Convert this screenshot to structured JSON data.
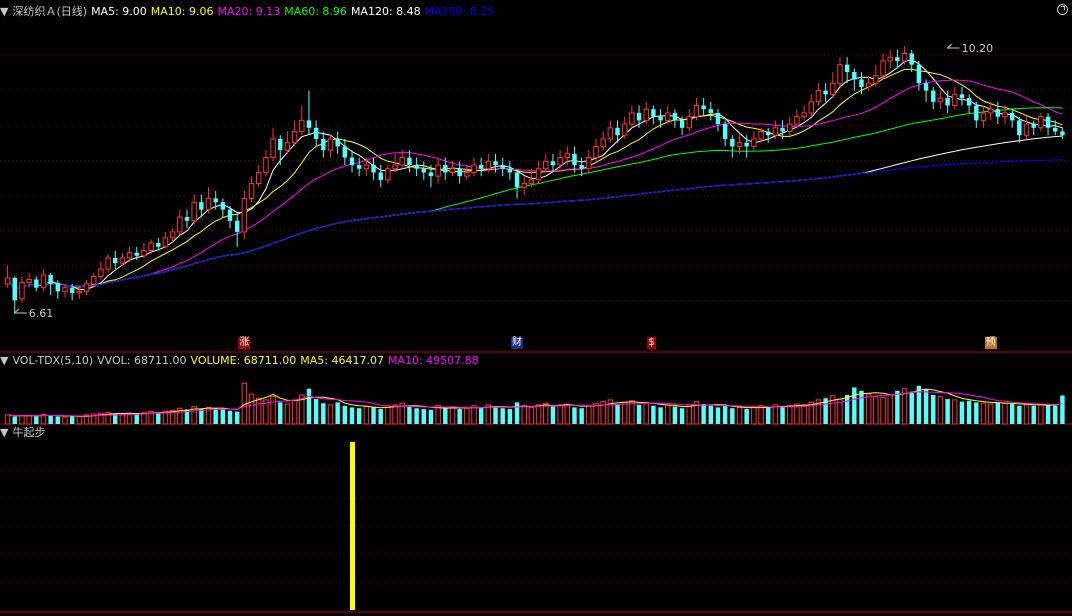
{
  "price_header": {
    "title": "深纺织Ａ(日线)",
    "items": [
      {
        "label": "MA5: 9.00",
        "color": "#ffffff"
      },
      {
        "label": "MA10: 9.06",
        "color": "#ffff00"
      },
      {
        "label": "MA20: 9.13",
        "color": "#ff00ff"
      },
      {
        "label": "MA60: 8.96",
        "color": "#00ff00"
      },
      {
        "label": "MA120: 8.48",
        "color": "#ffffff"
      },
      {
        "label": "MA250: 8.25",
        "color": "#0000ff"
      }
    ]
  },
  "volume_header": {
    "title": "VOL-TDX(5,10)",
    "items": [
      {
        "label": "VVOL: 68711.00",
        "color": "#c8c8c8"
      },
      {
        "label": "VOLUME: 68711.00",
        "color": "#ffff00"
      },
      {
        "label": "MA5: 46417.07",
        "color": "#ffff00"
      },
      {
        "label": "MA10: 49507.88",
        "color": "#ff00ff"
      }
    ]
  },
  "indicator_header": {
    "title": "牛起步"
  },
  "signals": [
    {
      "text": "涨",
      "index": 33,
      "bg": "#a00000"
    },
    {
      "text": "财",
      "index": 71,
      "bg": "#1a2a8c"
    },
    {
      "text": "$",
      "index": 90,
      "bg": "#a00000"
    },
    {
      "text": "预",
      "index": 137,
      "bg": "#c07020"
    }
  ],
  "colors": {
    "up": "#ff3232",
    "down": "#54ffff",
    "grid": "#6e0000",
    "divider": "#b40000",
    "indicator_bar": "#ffff00"
  },
  "chart_data": [
    {
      "type": "candlestick",
      "price_range": [
        6.3,
        10.55
      ],
      "max_label": "10.20",
      "min_label": "6.61",
      "max_value": 10.2,
      "min_value": 6.61,
      "max_index": 131,
      "min_index": 1,
      "ma_periods": [
        5,
        10,
        20,
        60,
        120,
        250
      ],
      "candles": [
        [
          7.0,
          7.08,
          7.25,
          6.95
        ],
        [
          7.08,
          6.78,
          7.1,
          6.61
        ],
        [
          6.8,
          7.02,
          7.1,
          6.75
        ],
        [
          7.02,
          7.06,
          7.15,
          6.95
        ],
        [
          7.06,
          6.95,
          7.1,
          6.9
        ],
        [
          6.95,
          7.12,
          7.2,
          6.9
        ],
        [
          7.12,
          7.0,
          7.15,
          6.85
        ],
        [
          7.0,
          6.9,
          7.05,
          6.8
        ],
        [
          6.9,
          6.95,
          7.0,
          6.82
        ],
        [
          6.95,
          6.88,
          7.0,
          6.78
        ],
        [
          6.88,
          6.9,
          6.98,
          6.8
        ],
        [
          6.9,
          7.0,
          7.05,
          6.85
        ],
        [
          7.0,
          7.1,
          7.15,
          6.95
        ],
        [
          7.1,
          7.2,
          7.3,
          7.05
        ],
        [
          7.2,
          7.35,
          7.4,
          7.15
        ],
        [
          7.35,
          7.28,
          7.45,
          7.2
        ],
        [
          7.28,
          7.35,
          7.42,
          7.25
        ],
        [
          7.35,
          7.42,
          7.5,
          7.3
        ],
        [
          7.42,
          7.38,
          7.5,
          7.32
        ],
        [
          7.38,
          7.45,
          7.55,
          7.35
        ],
        [
          7.45,
          7.55,
          7.6,
          7.4
        ],
        [
          7.55,
          7.5,
          7.62,
          7.45
        ],
        [
          7.5,
          7.62,
          7.7,
          7.48
        ],
        [
          7.62,
          7.7,
          7.75,
          7.55
        ],
        [
          7.7,
          7.9,
          8.0,
          7.65
        ],
        [
          7.9,
          7.85,
          8.0,
          7.75
        ],
        [
          7.85,
          8.1,
          8.2,
          7.8
        ],
        [
          8.1,
          8.0,
          8.2,
          7.9
        ],
        [
          8.0,
          8.15,
          8.3,
          7.95
        ],
        [
          8.15,
          8.1,
          8.25,
          8.0
        ],
        [
          8.1,
          8.0,
          8.15,
          7.9
        ],
        [
          8.0,
          7.85,
          8.05,
          7.75
        ],
        [
          7.85,
          7.7,
          7.95,
          7.5
        ],
        [
          7.7,
          8.15,
          8.25,
          7.6
        ],
        [
          8.15,
          8.35,
          8.45,
          8.1
        ],
        [
          8.35,
          8.5,
          8.6,
          8.3
        ],
        [
          8.5,
          8.7,
          8.8,
          8.45
        ],
        [
          8.7,
          8.95,
          9.1,
          8.65
        ],
        [
          8.95,
          8.8,
          9.0,
          8.6
        ],
        [
          8.8,
          8.9,
          9.05,
          8.75
        ],
        [
          8.9,
          9.05,
          9.2,
          8.85
        ],
        [
          9.05,
          9.2,
          9.4,
          9.0
        ],
        [
          9.2,
          9.1,
          9.6,
          9.0
        ],
        [
          9.1,
          8.95,
          9.2,
          8.85
        ],
        [
          8.95,
          8.8,
          9.05,
          8.7
        ],
        [
          8.8,
          8.95,
          9.0,
          8.7
        ],
        [
          8.95,
          8.85,
          9.05,
          8.75
        ],
        [
          8.85,
          8.7,
          8.95,
          8.6
        ],
        [
          8.7,
          8.6,
          8.8,
          8.5
        ],
        [
          8.6,
          8.55,
          8.7,
          8.45
        ],
        [
          8.55,
          8.6,
          8.7,
          8.45
        ],
        [
          8.6,
          8.5,
          8.7,
          8.4
        ],
        [
          8.5,
          8.4,
          8.6,
          8.3
        ],
        [
          8.4,
          8.55,
          8.6,
          8.35
        ],
        [
          8.55,
          8.6,
          8.75,
          8.5
        ],
        [
          8.6,
          8.7,
          8.8,
          8.55
        ],
        [
          8.7,
          8.6,
          8.8,
          8.5
        ],
        [
          8.6,
          8.55,
          8.7,
          8.45
        ],
        [
          8.55,
          8.5,
          8.65,
          8.4
        ],
        [
          8.5,
          8.45,
          8.6,
          8.3
        ],
        [
          8.45,
          8.6,
          8.7,
          8.35
        ],
        [
          8.6,
          8.5,
          8.7,
          8.4
        ],
        [
          8.5,
          8.55,
          8.65,
          8.45
        ],
        [
          8.55,
          8.45,
          8.65,
          8.35
        ],
        [
          8.45,
          8.5,
          8.6,
          8.4
        ],
        [
          8.5,
          8.6,
          8.7,
          8.45
        ],
        [
          8.6,
          8.55,
          8.7,
          8.45
        ],
        [
          8.55,
          8.65,
          8.75,
          8.5
        ],
        [
          8.65,
          8.6,
          8.75,
          8.5
        ],
        [
          8.6,
          8.55,
          8.7,
          8.45
        ],
        [
          8.55,
          8.5,
          8.65,
          8.4
        ],
        [
          8.5,
          8.3,
          8.55,
          8.15
        ],
        [
          8.3,
          8.35,
          8.45,
          8.2
        ],
        [
          8.35,
          8.4,
          8.55,
          8.3
        ],
        [
          8.4,
          8.55,
          8.65,
          8.35
        ],
        [
          8.55,
          8.65,
          8.75,
          8.5
        ],
        [
          8.65,
          8.6,
          8.75,
          8.5
        ],
        [
          8.6,
          8.7,
          8.8,
          8.55
        ],
        [
          8.7,
          8.75,
          8.85,
          8.6
        ],
        [
          8.75,
          8.6,
          8.85,
          8.5
        ],
        [
          8.6,
          8.55,
          8.7,
          8.45
        ],
        [
          8.55,
          8.7,
          8.8,
          8.5
        ],
        [
          8.7,
          8.85,
          8.95,
          8.65
        ],
        [
          8.85,
          8.95,
          9.05,
          8.8
        ],
        [
          8.95,
          9.1,
          9.2,
          8.9
        ],
        [
          9.1,
          9.0,
          9.2,
          8.9
        ],
        [
          9.0,
          9.15,
          9.25,
          8.95
        ],
        [
          9.15,
          9.3,
          9.4,
          9.1
        ],
        [
          9.3,
          9.2,
          9.4,
          9.1
        ],
        [
          9.2,
          9.35,
          9.45,
          9.15
        ],
        [
          9.35,
          9.25,
          9.4,
          9.15
        ],
        [
          9.25,
          9.2,
          9.35,
          9.1
        ],
        [
          9.2,
          9.3,
          9.4,
          9.15
        ],
        [
          9.3,
          9.2,
          9.35,
          9.1
        ],
        [
          9.2,
          9.1,
          9.25,
          9.0
        ],
        [
          9.1,
          9.25,
          9.35,
          9.05
        ],
        [
          9.25,
          9.4,
          9.5,
          9.2
        ],
        [
          9.4,
          9.35,
          9.5,
          9.25
        ],
        [
          9.35,
          9.3,
          9.45,
          9.2
        ],
        [
          9.3,
          9.15,
          9.35,
          9.05
        ],
        [
          9.15,
          8.95,
          9.2,
          8.85
        ],
        [
          8.95,
          8.85,
          9.0,
          8.7
        ],
        [
          8.85,
          8.9,
          9.0,
          8.75
        ],
        [
          8.9,
          8.85,
          9.0,
          8.7
        ],
        [
          8.85,
          8.95,
          9.05,
          8.8
        ],
        [
          8.95,
          9.05,
          9.1,
          8.9
        ],
        [
          9.05,
          9.0,
          9.1,
          8.9
        ],
        [
          9.0,
          9.1,
          9.2,
          8.95
        ],
        [
          9.1,
          9.05,
          9.2,
          8.95
        ],
        [
          9.05,
          9.15,
          9.25,
          9.0
        ],
        [
          9.15,
          9.25,
          9.35,
          9.1
        ],
        [
          9.25,
          9.3,
          9.4,
          9.2
        ],
        [
          9.3,
          9.45,
          9.55,
          9.25
        ],
        [
          9.45,
          9.6,
          9.7,
          9.4
        ],
        [
          9.6,
          9.55,
          9.7,
          9.45
        ],
        [
          9.55,
          9.7,
          9.85,
          9.5
        ],
        [
          9.7,
          9.95,
          10.05,
          9.65
        ],
        [
          9.95,
          9.85,
          10.05,
          9.7
        ],
        [
          9.85,
          9.75,
          9.9,
          9.6
        ],
        [
          9.75,
          9.65,
          9.85,
          9.55
        ],
        [
          9.65,
          9.7,
          9.8,
          9.6
        ],
        [
          9.7,
          9.8,
          9.95,
          9.65
        ],
        [
          9.8,
          10.0,
          10.1,
          9.75
        ],
        [
          10.0,
          10.05,
          10.15,
          9.9
        ],
        [
          10.05,
          10.0,
          10.15,
          9.9
        ],
        [
          10.0,
          10.1,
          10.2,
          9.95
        ],
        [
          10.1,
          9.95,
          10.15,
          9.85
        ],
        [
          9.95,
          9.7,
          10.0,
          9.6
        ],
        [
          9.7,
          9.6,
          9.75,
          9.45
        ],
        [
          9.6,
          9.45,
          9.65,
          9.35
        ],
        [
          9.45,
          9.5,
          9.6,
          9.35
        ],
        [
          9.5,
          9.4,
          9.6,
          9.3
        ],
        [
          9.4,
          9.55,
          9.65,
          9.35
        ],
        [
          9.55,
          9.5,
          9.65,
          9.4
        ],
        [
          9.5,
          9.4,
          9.55,
          9.3
        ],
        [
          9.4,
          9.2,
          9.45,
          9.1
        ],
        [
          9.2,
          9.3,
          9.4,
          9.1
        ],
        [
          9.3,
          9.35,
          9.45,
          9.2
        ],
        [
          9.35,
          9.25,
          9.45,
          9.15
        ],
        [
          9.25,
          9.3,
          9.4,
          9.15
        ],
        [
          9.3,
          9.2,
          9.35,
          9.1
        ],
        [
          9.2,
          9.0,
          9.25,
          8.9
        ],
        [
          9.0,
          9.15,
          9.25,
          8.95
        ],
        [
          9.15,
          9.1,
          9.2,
          9.0
        ],
        [
          9.1,
          9.25,
          9.3,
          9.05
        ],
        [
          9.25,
          9.1,
          9.3,
          9.0
        ],
        [
          9.1,
          9.05,
          9.2,
          9.0
        ],
        [
          9.05,
          9.0,
          9.1,
          8.95
        ]
      ]
    },
    {
      "type": "bar",
      "series_name": "VOLUME",
      "volume_range": [
        0,
        130000
      ],
      "volumes": [
        22000,
        18000,
        20000,
        21000,
        19000,
        23000,
        20000,
        18000,
        17000,
        19000,
        18000,
        22000,
        24000,
        26000,
        28000,
        25000,
        23000,
        26000,
        24000,
        27000,
        30000,
        28000,
        31000,
        33000,
        38000,
        35000,
        42000,
        36000,
        40000,
        38000,
        35000,
        32000,
        30000,
        98000,
        72000,
        62000,
        58000,
        66000,
        52000,
        48000,
        58000,
        70000,
        85000,
        60000,
        50000,
        46000,
        52000,
        44000,
        40000,
        38000,
        42000,
        40000,
        36000,
        44000,
        46000,
        50000,
        42000,
        38000,
        36000,
        34000,
        45000,
        38000,
        40000,
        36000,
        38000,
        44000,
        40000,
        46000,
        42000,
        38000,
        36000,
        52000,
        44000,
        40000,
        46000,
        50000,
        42000,
        46000,
        48000,
        40000,
        38000,
        44000,
        50000,
        54000,
        58000,
        48000,
        52000,
        56000,
        46000,
        52000,
        44000,
        40000,
        46000,
        42000,
        38000,
        46000,
        54000,
        48000,
        44000,
        40000,
        44000,
        38000,
        40000,
        36000,
        40000,
        44000,
        40000,
        46000,
        42000,
        44000,
        48000,
        46000,
        52000,
        58000,
        62000,
        68000,
        60000,
        70000,
        88000,
        80000,
        72000,
        66000,
        64000,
        70000,
        80000,
        86000,
        78000,
        92000,
        84000,
        70000,
        66000,
        60000,
        58000,
        54000,
        56000,
        52000,
        50000,
        48000,
        52000,
        50000,
        48000,
        44000,
        46000,
        44000,
        48000,
        46000,
        44000,
        68711
      ]
    },
    {
      "type": "bar",
      "series_name": "牛起步",
      "signal_index": 48,
      "signal_value": 1
    }
  ]
}
